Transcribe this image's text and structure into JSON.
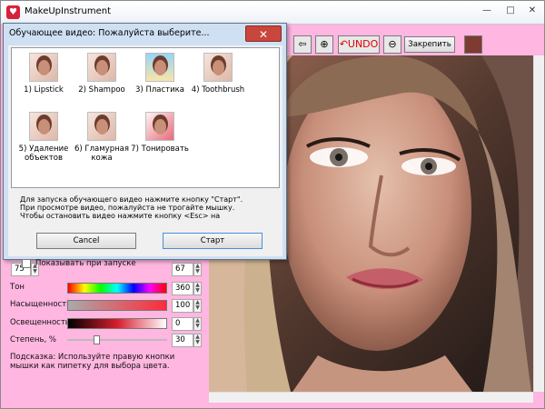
{
  "app": {
    "title": "MakeUpInstrument",
    "close": "✕",
    "minimize": "—",
    "maximize": "□",
    "fix_button": "Закрепить"
  },
  "toolbar": {
    "icons": [
      "arrow-icon",
      "zoom-in-icon",
      "undo-icon",
      "redo-icon",
      "zoom-out-icon"
    ]
  },
  "panel": {
    "top_left": "75",
    "top_right": "67",
    "tone_label": "Тон",
    "tone_value": "360",
    "saturation_label": "Насыщенность",
    "saturation_value": "100",
    "lightness_label": "Освещенность",
    "lightness_value": "0",
    "degree_label": "Степень, %",
    "degree_value": "30",
    "hint": "Подсказка: Используйте правую кнопки мышки как пипетку для выбора цвета."
  },
  "dialog": {
    "title": "Обучающее видео: Пожалуйста выберите...",
    "items": [
      {
        "label": "1) Lipstick"
      },
      {
        "label": "2) Shampoo"
      },
      {
        "label": "3) Пластика"
      },
      {
        "label": "4) Toothbrush"
      },
      {
        "label": "5) Удаление объектов"
      },
      {
        "label": "6) Гламурная кожа"
      },
      {
        "label": "7) Тонировать"
      }
    ],
    "instructions": "Для запуска обучающего видео нажмите кнопку \"Старт\".\nПри просмотре видео, пожалуйста не трогайте мышку.\nЧтобы остановить видео нажмите кнопку <Esc> на",
    "cancel": "Cancel",
    "start": "Старт",
    "show_at_start": "Показывать при запуске"
  },
  "colors": {
    "accent": "#ffb6e0",
    "dialog": "#cfe0f3"
  }
}
